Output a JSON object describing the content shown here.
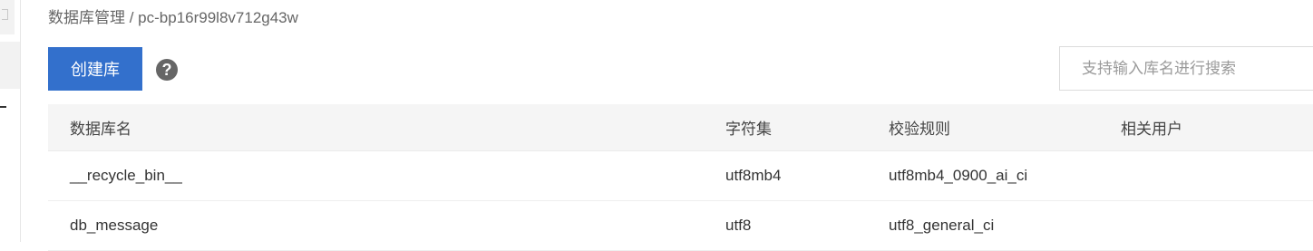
{
  "breadcrumb": {
    "section": "数据库管理",
    "separator": " / ",
    "instance": "pc-bp16r99l8v712g43w"
  },
  "toolbar": {
    "create_label": "创建库",
    "help_glyph": "?"
  },
  "search": {
    "placeholder": "支持输入库名进行搜索",
    "value": ""
  },
  "table": {
    "headers": [
      "数据库名",
      "字符集",
      "校验规则",
      "相关用户"
    ],
    "rows": [
      {
        "name": "__recycle_bin__",
        "charset": "utf8mb4",
        "collation": "utf8mb4_0900_ai_ci",
        "users": ""
      },
      {
        "name": "db_message",
        "charset": "utf8",
        "collation": "utf8_general_ci",
        "users": ""
      }
    ]
  },
  "colors": {
    "primary": "#3370cc",
    "header_bg": "#f5f5f5",
    "help_icon": "#666666"
  },
  "icons": {
    "help": "question-circle-icon",
    "rail": "collapse-dash-icon"
  }
}
